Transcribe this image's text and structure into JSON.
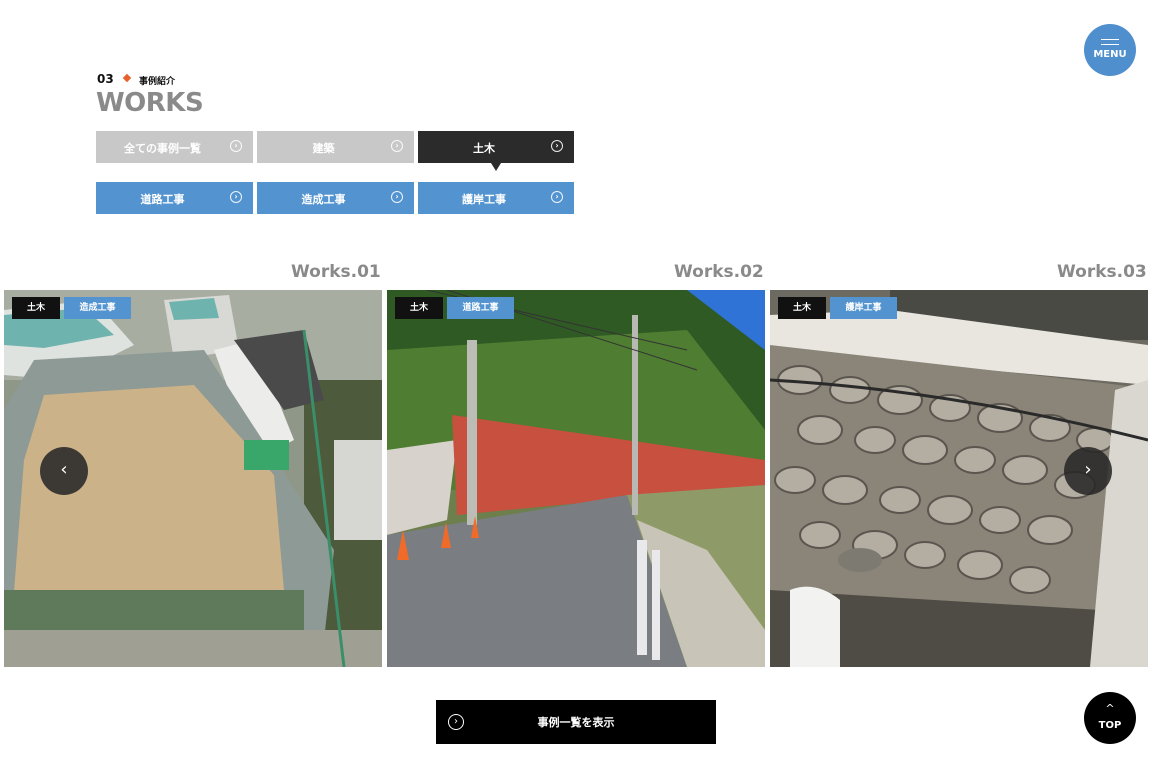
{
  "menu": {
    "label": "MENU"
  },
  "top_button": {
    "label": "TOP",
    "chevron": "^"
  },
  "section": {
    "number": "03",
    "jp_label": "事例紹介",
    "title": "WORKS"
  },
  "filter_tabs": [
    {
      "label": "全ての事例一覧",
      "state": "inactive"
    },
    {
      "label": "建築",
      "state": "inactive"
    },
    {
      "label": "土木",
      "state": "active"
    }
  ],
  "sub_tabs": [
    {
      "label": "道路工事"
    },
    {
      "label": "造成工事"
    },
    {
      "label": "護岸工事"
    }
  ],
  "tab_arrow_glyph": "›",
  "works": [
    {
      "label": "Works.01",
      "tags": [
        "土木",
        "造成工事"
      ],
      "image": "aerial-school-grounds-photo"
    },
    {
      "label": "Works.02",
      "tags": [
        "土木",
        "道路工事"
      ],
      "image": "road-construction-photo"
    },
    {
      "label": "Works.03",
      "tags": [
        "土木",
        "護岸工事"
      ],
      "image": "stone-retaining-wall-photo"
    }
  ],
  "carousel": {
    "prev_glyph": "‹",
    "next_glyph": "›"
  },
  "view_all_button": {
    "label": "事例一覧を表示",
    "icon_glyph": "›"
  },
  "colors": {
    "accent_blue": "#5394d0",
    "active_dark": "#2b2b2b",
    "inactive_gray": "#c8c8c8",
    "diamond": "#e8602c",
    "title_gray": "#8a8a8a"
  }
}
